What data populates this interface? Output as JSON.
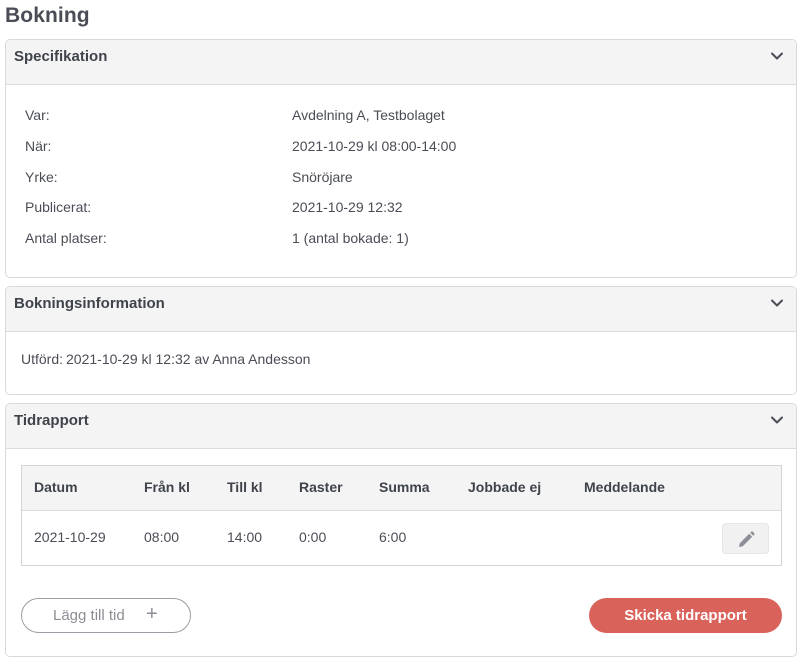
{
  "page": {
    "title": "Bokning"
  },
  "specification": {
    "title": "Specifikation",
    "rows": [
      {
        "label": "Var:",
        "value": "Avdelning A, Testbolaget"
      },
      {
        "label": "När:",
        "value": "2021-10-29 kl 08:00-14:00"
      },
      {
        "label": "Yrke:",
        "value": "Snöröjare"
      },
      {
        "label": "Publicerat:",
        "value": "2021-10-29 12:32"
      },
      {
        "label": "Antal platser:",
        "value": "1 (antal bokade: 1)"
      }
    ]
  },
  "booking_info": {
    "title": "Bokningsinformation",
    "label": "Utförd:",
    "value": "2021-10-29 kl 12:32 av Anna Andesson"
  },
  "time_report": {
    "title": "Tidrapport",
    "columns": [
      "Datum",
      "Från kl",
      "Till kl",
      "Raster",
      "Summa",
      "Jobbade ej",
      "Meddelande"
    ],
    "rows": [
      {
        "datum": "2021-10-29",
        "fran": "08:00",
        "till": "14:00",
        "raster": "0:00",
        "summa": "6:00",
        "jobbade_ej": "",
        "meddelande": ""
      }
    ],
    "add_button": {
      "label": "Lägg till tid",
      "icon": "plus-icon"
    },
    "send_button": {
      "label": "Skicka tidrapport"
    }
  },
  "colors": {
    "accent": "#d9625a",
    "header_bg": "#f4f4f5",
    "border": "#d9d9d9",
    "text": "#4a4d55"
  }
}
